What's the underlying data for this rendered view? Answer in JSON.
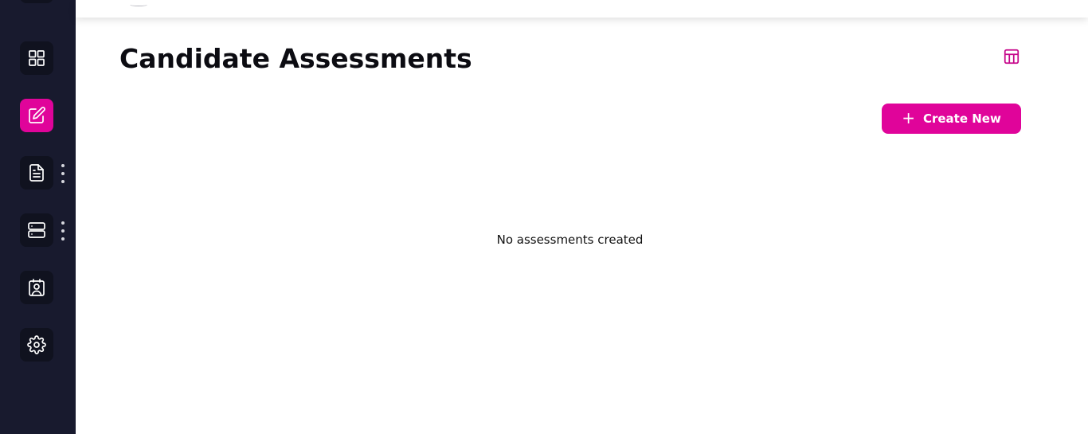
{
  "sidebar": {
    "items": [
      {
        "name": "dashboard",
        "icon": "grid-icon",
        "active": false
      },
      {
        "name": "assessments",
        "icon": "edit-icon",
        "active": true
      },
      {
        "name": "documents",
        "icon": "document-icon",
        "active": false,
        "has_more": true
      },
      {
        "name": "servers",
        "icon": "server-icon",
        "active": false,
        "has_more": true
      },
      {
        "name": "candidates",
        "icon": "contact-card-icon",
        "active": false
      },
      {
        "name": "settings",
        "icon": "gear-icon",
        "active": false
      }
    ]
  },
  "header": {
    "title": "Candidate Assessments",
    "layout_icon": "layout-icon"
  },
  "actions": {
    "create_label": "Create New",
    "create_icon": "plus-icon"
  },
  "main": {
    "empty_message": "No assessments created"
  },
  "colors": {
    "accent": "#e0049a",
    "sidebar_bg": "#181a2e",
    "nav_tile_bg": "#10121f"
  }
}
